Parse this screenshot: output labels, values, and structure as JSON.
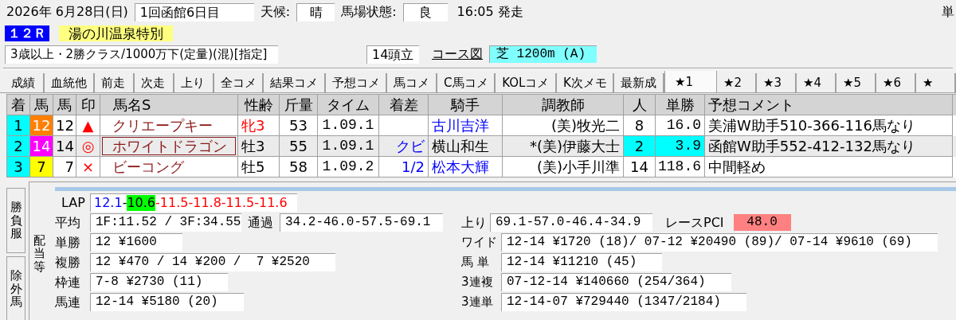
{
  "header": {
    "date": "2026年 6月28日(日)",
    "meeting": "1回函館6日目",
    "weather_label": "天候:",
    "weather": "晴",
    "track_label": "馬場状態:",
    "track": "良",
    "post_time": "16:05 発走",
    "corner_text": "単"
  },
  "race": {
    "number": "１２Ｒ",
    "name": "湯の川温泉特別",
    "conditions": "3歳以上・2勝クラス/1000万下(定量)(混)[指定]",
    "runners": "14頭立",
    "course_link": "コース図",
    "course": "芝 1200m (A)"
  },
  "tabs": [
    {
      "label": "成績",
      "selected": false
    },
    {
      "label": "血統他",
      "selected": false
    },
    {
      "label": "前走",
      "selected": false
    },
    {
      "label": "次走",
      "selected": false
    },
    {
      "label": "上り",
      "selected": false
    },
    {
      "label": "全コメ",
      "selected": false
    },
    {
      "label": "結果コメ",
      "selected": false
    },
    {
      "label": "予想コメ",
      "selected": false
    },
    {
      "label": "馬コメ",
      "selected": false
    },
    {
      "label": "C馬コメ",
      "selected": false
    },
    {
      "label": "KOLコメ",
      "selected": false
    },
    {
      "label": "K次メモ",
      "selected": false
    },
    {
      "label": "最新成",
      "selected": false
    },
    {
      "label": "★1",
      "selected": true
    },
    {
      "label": "★2",
      "selected": false
    },
    {
      "label": "★3",
      "selected": false
    },
    {
      "label": "★4",
      "selected": false
    },
    {
      "label": "★5",
      "selected": false
    },
    {
      "label": "★6",
      "selected": false
    },
    {
      "label": "★",
      "selected": false
    }
  ],
  "table": {
    "columns": [
      "着",
      "馬",
      "馬",
      "印",
      "馬名S",
      "性齢",
      "斤量",
      "タイム",
      "着差",
      "騎手",
      "調教師",
      "人",
      "単勝",
      "予想コメント"
    ],
    "rows": [
      {
        "finish": "1",
        "frame": {
          "text": "12",
          "color": "#ff8000"
        },
        "number": "12",
        "mark": "▲",
        "name": "クリエープキー",
        "sex_age": {
          "text": "牝3",
          "color": "#ff0000"
        },
        "weight": "53",
        "time": "1.09.1",
        "margin": "",
        "jockey": {
          "text": "古川吉洋",
          "color": "#0000ff"
        },
        "trainer": "(美)牧光二",
        "popularity": "8",
        "odds": "16.0",
        "comment": "美浦W助手510-366-116馬なり",
        "selected": false,
        "highlight": false
      },
      {
        "finish": "2",
        "frame": {
          "text": "14",
          "color": "#ff00ff"
        },
        "number": "14",
        "mark": "◎",
        "name": "ホワイトドラゴン",
        "sex_age": {
          "text": "牡3",
          "color": "#000000"
        },
        "weight": "55",
        "time": "1.09.1",
        "margin": "クビ",
        "jockey": {
          "text": "横山和生",
          "color": "#000000"
        },
        "trainer": "*(美)伊藤大士",
        "popularity": "2",
        "odds": "3.9",
        "comment": "函館W助手552-412-132馬なり",
        "selected": true,
        "highlight": true
      },
      {
        "finish": "3",
        "frame": {
          "text": "7",
          "color": "#ffff00"
        },
        "number": "7",
        "mark": "×",
        "name": "ビーコング",
        "sex_age": {
          "text": "牡5",
          "color": "#000000"
        },
        "weight": "58",
        "time": "1.09.2",
        "margin": "1/2",
        "jockey": {
          "text": "松本大輝",
          "color": "#0000ff"
        },
        "trainer": "(美)小手川準",
        "popularity": "14",
        "odds": "118.6",
        "comment": "中間軽め",
        "selected": false,
        "highlight": false
      }
    ]
  },
  "side_tabs": [
    "勝負服",
    "除外馬"
  ],
  "section_label": "配当等",
  "results": {
    "lap": {
      "label": "LAP",
      "segments": [
        {
          "text": "12.1",
          "color": "#0000ff",
          "highlight": false
        },
        {
          "text": "-",
          "color": "#000000",
          "highlight": false
        },
        {
          "text": "10.6",
          "highlight": true
        },
        {
          "text": "-11.5-11.8-11.5-11.6",
          "color": "#ff0000",
          "highlight": false
        }
      ]
    },
    "average": {
      "label": "平均",
      "value": "1F:11.52 / 3F:34.55"
    },
    "passing": {
      "label": "通過",
      "value": "34.2-46.0-57.5-69.1"
    },
    "last": {
      "label": "上り",
      "value": "69.1-57.0-46.4-34.9"
    },
    "pci": {
      "label": "レースPCI",
      "value": "48.0"
    },
    "left_rows": [
      {
        "label": "単勝",
        "value": "12 ¥1600"
      },
      {
        "label": "複勝",
        "value": "12 ¥470 / 14 ¥200 /  7 ¥2520"
      },
      {
        "label": "枠連",
        "value": "7-8 ¥2730 (11)"
      },
      {
        "label": "馬連",
        "value": "12-14 ¥5180 (20)"
      }
    ],
    "right_rows": [
      {
        "label": "ワイド",
        "value": "12-14 ¥1720 (18)/ 07-12 ¥20490 (89)/ 07-14 ¥9610 (69)"
      },
      {
        "label": "馬 単",
        "value": "12-14 ¥11210 (45)"
      },
      {
        "label": "3連複",
        "value": "07-12-14 ¥140660 (254/364)"
      },
      {
        "label": "3連単",
        "value": "12-14-07 ¥729440 (1347/2184)"
      }
    ]
  }
}
